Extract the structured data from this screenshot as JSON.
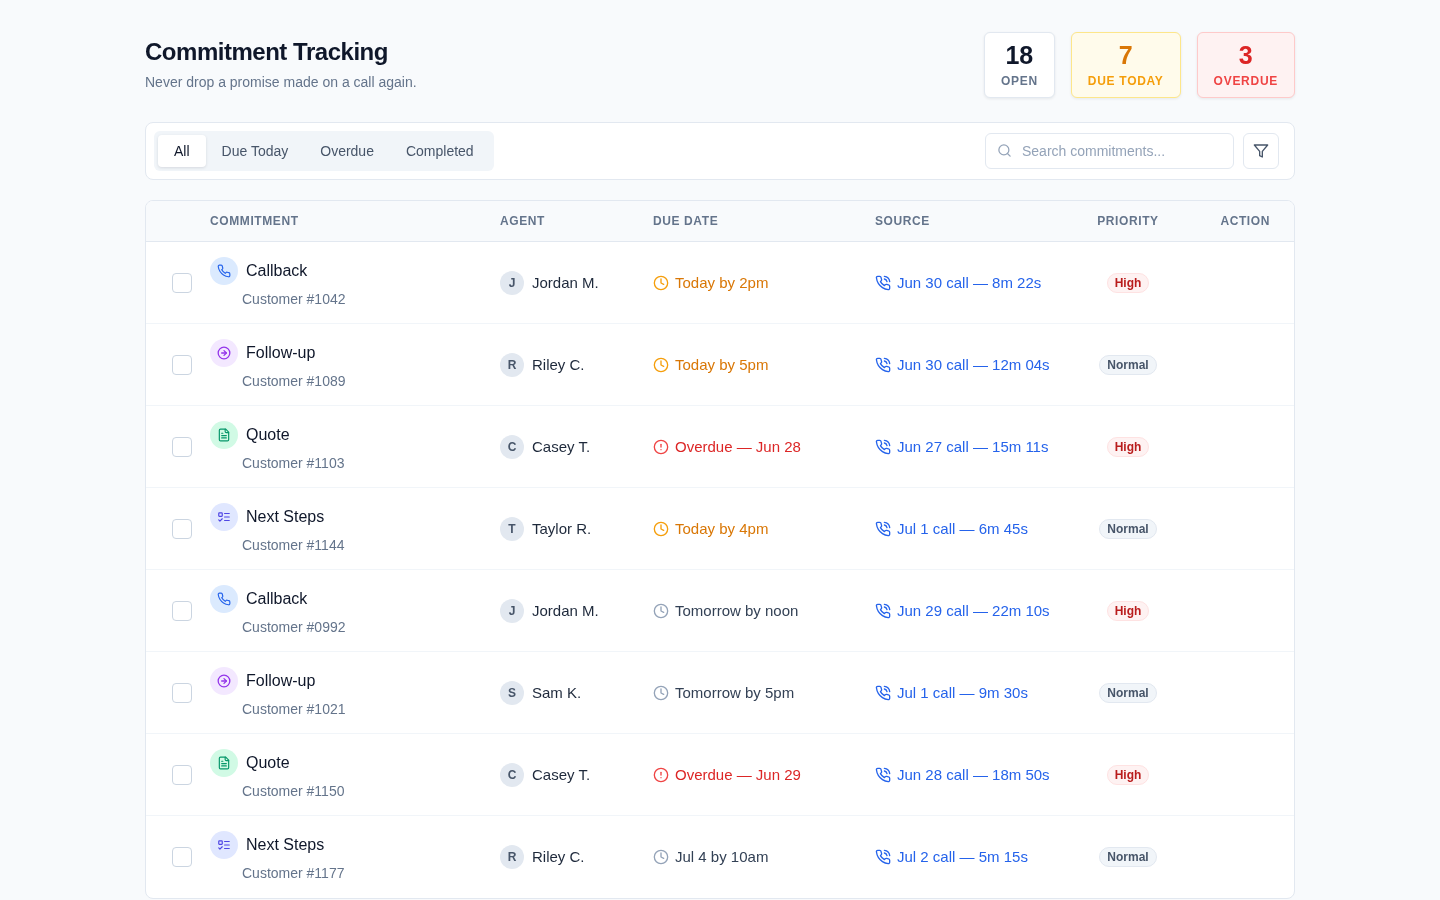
{
  "header": {
    "title": "Commitment Tracking",
    "subtitle": "Never drop a promise made on a call again."
  },
  "stats": [
    {
      "value": "18",
      "label": "OPEN",
      "kind": "neutral"
    },
    {
      "value": "7",
      "label": "DUE TODAY",
      "kind": "warning"
    },
    {
      "value": "3",
      "label": "OVERDUE",
      "kind": "danger"
    }
  ],
  "toolbar": {
    "tabs": [
      {
        "label": "All",
        "selected": true
      },
      {
        "label": "Due Today",
        "selected": false
      },
      {
        "label": "Overdue",
        "selected": false
      },
      {
        "label": "Completed",
        "selected": false
      }
    ],
    "search": {
      "placeholder": "Search commitments..."
    }
  },
  "table": {
    "columns": [
      "COMMITMENT",
      "AGENT",
      "DUE DATE",
      "SOURCE",
      "PRIORITY",
      "ACTION"
    ],
    "rows": [
      {
        "checked": false,
        "kind": "callback",
        "title": "Callback",
        "customer": "Customer #1042",
        "agent": {
          "initial": "J",
          "name": "Jordan M."
        },
        "due": {
          "kind": "today",
          "text": "Today by 2pm"
        },
        "source": "Jun 30 call — 8m 22s",
        "priority": {
          "kind": "high",
          "label": "High"
        }
      },
      {
        "checked": false,
        "kind": "followup",
        "title": "Follow-up",
        "customer": "Customer #1089",
        "agent": {
          "initial": "R",
          "name": "Riley C."
        },
        "due": {
          "kind": "today",
          "text": "Today by 5pm"
        },
        "source": "Jun 30 call — 12m 04s",
        "priority": {
          "kind": "normal",
          "label": "Normal"
        }
      },
      {
        "checked": false,
        "kind": "quote",
        "title": "Quote",
        "customer": "Customer #1103",
        "agent": {
          "initial": "C",
          "name": "Casey T."
        },
        "due": {
          "kind": "overdue",
          "text": "Overdue — Jun 28"
        },
        "source": "Jun 27 call — 15m 11s",
        "priority": {
          "kind": "high",
          "label": "High"
        }
      },
      {
        "checked": false,
        "kind": "next_steps",
        "title": "Next Steps",
        "customer": "Customer #1144",
        "agent": {
          "initial": "T",
          "name": "Taylor R."
        },
        "due": {
          "kind": "today",
          "text": "Today by 4pm"
        },
        "source": "Jul 1 call — 6m 45s",
        "priority": {
          "kind": "normal",
          "label": "Normal"
        }
      },
      {
        "checked": false,
        "kind": "callback",
        "title": "Callback",
        "customer": "Customer #0992",
        "agent": {
          "initial": "J",
          "name": "Jordan M."
        },
        "due": {
          "kind": "upcoming",
          "text": "Tomorrow by noon"
        },
        "source": "Jun 29 call — 22m 10s",
        "priority": {
          "kind": "high",
          "label": "High"
        }
      },
      {
        "checked": false,
        "kind": "followup",
        "title": "Follow-up",
        "customer": "Customer #1021",
        "agent": {
          "initial": "S",
          "name": "Sam K."
        },
        "due": {
          "kind": "upcoming",
          "text": "Tomorrow by 5pm"
        },
        "source": "Jul 1 call — 9m 30s",
        "priority": {
          "kind": "normal",
          "label": "Normal"
        }
      },
      {
        "checked": false,
        "kind": "quote",
        "title": "Quote",
        "customer": "Customer #1150",
        "agent": {
          "initial": "C",
          "name": "Casey T."
        },
        "due": {
          "kind": "overdue",
          "text": "Overdue — Jun 29"
        },
        "source": "Jun 28 call — 18m 50s",
        "priority": {
          "kind": "high",
          "label": "High"
        }
      },
      {
        "checked": false,
        "kind": "next_steps",
        "title": "Next Steps",
        "customer": "Customer #1177",
        "agent": {
          "initial": "R",
          "name": "Riley C."
        },
        "due": {
          "kind": "upcoming",
          "text": "Jul 4 by 10am"
        },
        "source": "Jul 2 call — 5m 15s",
        "priority": {
          "kind": "normal",
          "label": "Normal"
        }
      }
    ]
  }
}
